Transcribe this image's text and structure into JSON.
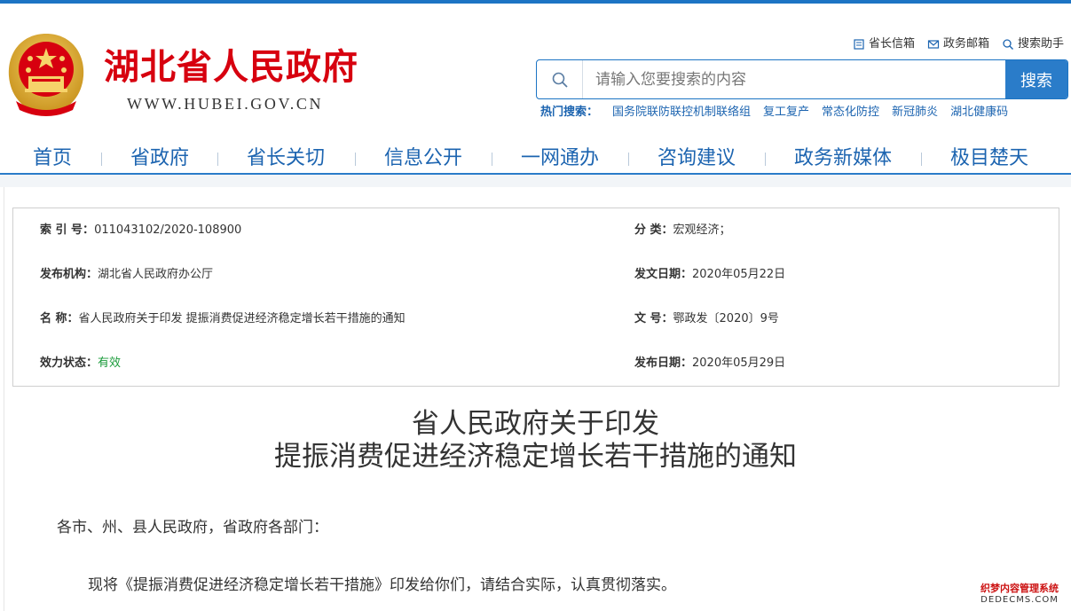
{
  "header": {
    "site_name": "湖北省人民政府",
    "site_url": "WWW.HUBEI.GOV.CN",
    "quick_links": [
      {
        "label": "省长信箱",
        "icon": "document-icon"
      },
      {
        "label": "政务邮箱",
        "icon": "mail-icon"
      },
      {
        "label": "搜索助手",
        "icon": "search-icon"
      }
    ]
  },
  "search": {
    "placeholder": "请输入您要搜索的内容",
    "button_label": "搜索",
    "hot_label": "热门搜索：",
    "hot_items": [
      "国务院联防联控机制联络组",
      "复工复产",
      "常态化防控",
      "新冠肺炎",
      "湖北健康码"
    ]
  },
  "nav": {
    "items": [
      "首页",
      "省政府",
      "省长关切",
      "信息公开",
      "一网通办",
      "咨询建议",
      "政务新媒体",
      "极目楚天"
    ]
  },
  "meta": {
    "index_key": "索 引 号：",
    "index_value": "011043102/2020-108900",
    "category_key": "分 类：",
    "category_value": "宏观经济；",
    "publisher_key": "发布机构：",
    "publisher_value": "湖北省人民政府办公厅",
    "issue_date_key": "发文日期：",
    "issue_date_value": "2020年05月22日",
    "name_key": "名 称：",
    "name_value": "省人民政府关于印发 提振消费促进经济稳定增长若干措施的通知",
    "doc_no_key": "文 号：",
    "doc_no_value": "鄂政发〔2020〕9号",
    "status_key": "效力状态：",
    "status_value": "有效",
    "publish_date_key": "发布日期：",
    "publish_date_value": "2020年05月29日"
  },
  "document": {
    "title_line1": "省人民政府关于印发",
    "title_line2": "提振消费促进经济稳定增长若干措施的通知",
    "salutation": "各市、州、县人民政府，省政府各部门：",
    "body": "现将《提振消费促进经济稳定增长若干措施》印发给你们，请结合实际，认真贯彻落实。"
  },
  "watermark": {
    "line1": "织梦内容管理系统",
    "line2": "DEDECMS.COM"
  },
  "colors": {
    "brand_red": "#d7000f",
    "brand_blue": "#1c74c4",
    "link_blue": "#1c64b0",
    "status_green": "#1a9b3a"
  }
}
